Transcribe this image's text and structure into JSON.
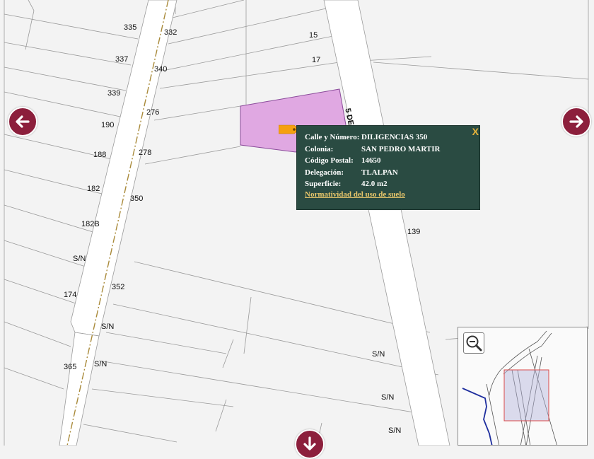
{
  "map": {
    "parcel_labels": [
      "335",
      "332",
      "337",
      "340",
      "339",
      "276",
      "190",
      "278",
      "188",
      "182",
      "350",
      "182B",
      "S/N",
      "174",
      "352",
      "S/N",
      "365",
      "S/N",
      "S/N",
      "S/N",
      "S/N",
      "15",
      "17",
      "139"
    ],
    "street_label": "5 DE",
    "highlight_color": "#e0a8e2",
    "pin_color": "#f5a00f"
  },
  "popup": {
    "rows": [
      {
        "key": "Calle y Número:",
        "value": "DILIGENCIAS 350"
      },
      {
        "key": "Colonia:",
        "value": "SAN PEDRO MARTIR"
      },
      {
        "key": "Código Postal:",
        "value": "14650"
      },
      {
        "key": "Delegación:",
        "value": "TLALPAN"
      },
      {
        "key": "Superficie:",
        "value": "42.0 m2"
      }
    ],
    "link": "Normatividad del uso de suelo",
    "close": "X"
  },
  "nav": {
    "left": "arrow-left-icon",
    "right": "arrow-right-icon",
    "down": "arrow-down-icon",
    "color": "#8c1f3c"
  },
  "minimap": {
    "zoom_icon": "zoom-out-icon"
  }
}
